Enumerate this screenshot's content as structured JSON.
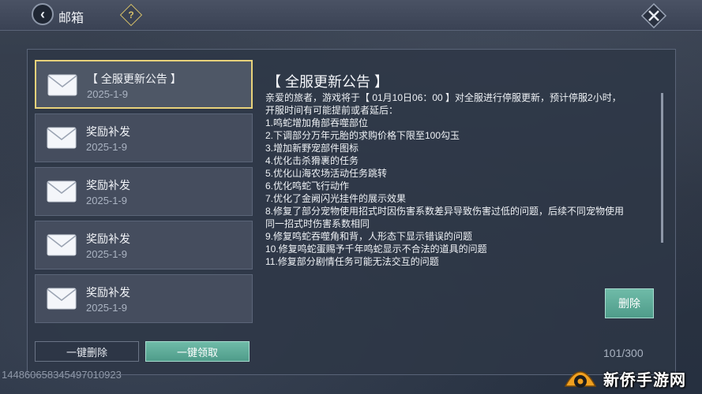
{
  "header": {
    "title": "邮箱",
    "help_symbol": "?"
  },
  "mail_list": [
    {
      "title": "【 全服更新公告 】",
      "date": "2025-1-9"
    },
    {
      "title": "奖励补发",
      "date": "2025-1-9"
    },
    {
      "title": "奖励补发",
      "date": "2025-1-9"
    },
    {
      "title": "奖励补发",
      "date": "2025-1-9"
    },
    {
      "title": "奖励补发",
      "date": "2025-1-9"
    }
  ],
  "content": {
    "title": "【 全服更新公告 】",
    "lines": [
      "亲爱的旅者，游戏将于【 01月10日06：00 】对全服进行停服更新，预计停服2小时，",
      "开服时间有可能提前或者延后：",
      "1.鸣蛇增加角部吞噬部位",
      "2.下调部分万年元胎的求购价格下限至100勾玉",
      "3.增加新野宠部件图标",
      "4.优化击杀猾裹的任务",
      "5.优化山海农场活动任务跳转",
      "6.优化鸣蛇飞行动作",
      "7.优化了金阙闪光挂件的展示效果",
      "8.修复了部分宠物使用招式时因伤害系数差异导致伤害过低的问题，后续不同宠物使用",
      "同一招式时伤害系数相同",
      "9.修复鸣蛇吞噬角和背，人形态下显示错误的问题",
      "10.修复鸣蛇蛋赐予千年鸣蛇显示不合法的道具的问题",
      "11.修复部分剧情任务可能无法交互的问题"
    ]
  },
  "buttons": {
    "delete": "删除",
    "delete_all": "一键删除",
    "claim_all": "一键领取"
  },
  "mail_count": "101/300",
  "user_id": "144860658345497010923",
  "watermark": "新侨手游网",
  "colors": {
    "accent_green": "#5fab98",
    "selected_border": "#e8d27a",
    "help_gold": "#d6c06a"
  }
}
